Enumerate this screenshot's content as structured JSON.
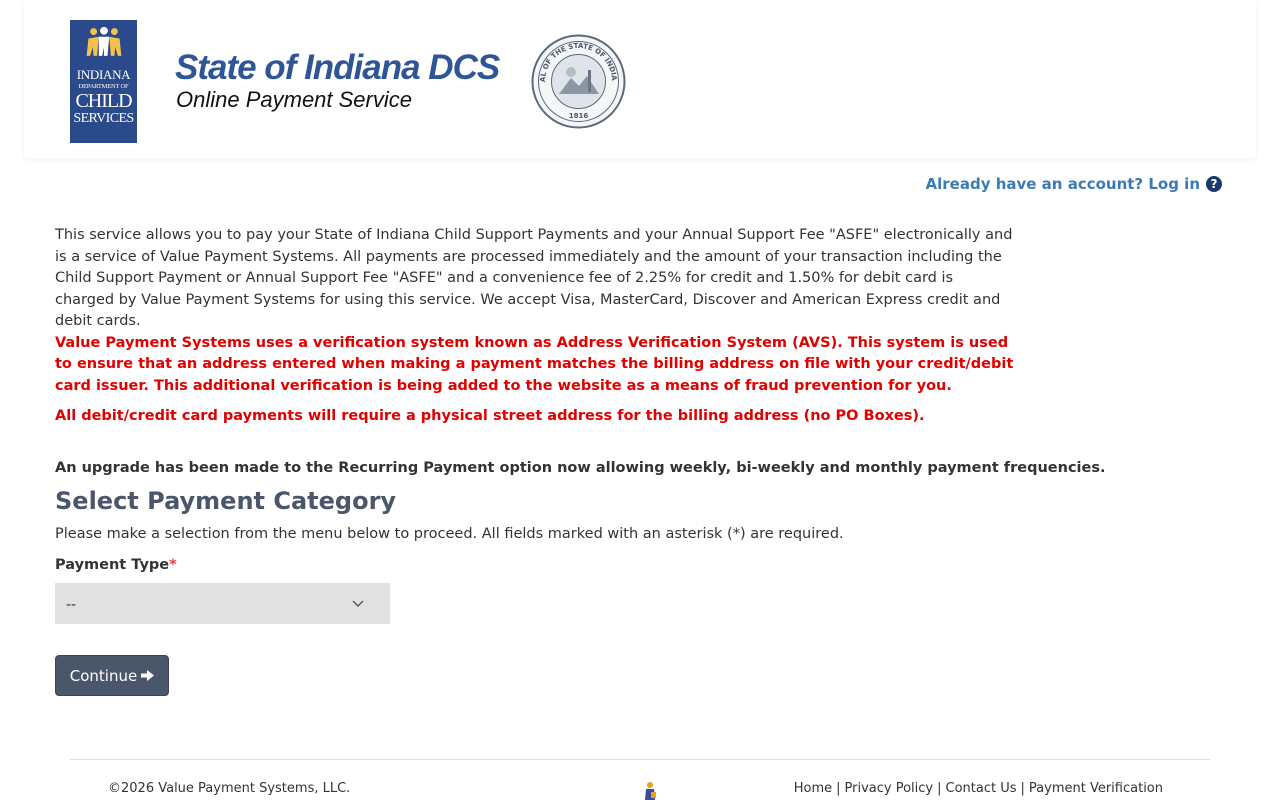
{
  "header": {
    "logo": {
      "line1": "INDIANA",
      "line2": "DEPARTMENT OF",
      "line3": "CHILD",
      "line4": "SERVICES"
    },
    "title": "State of Indiana DCS",
    "subtitle": "Online Payment Service",
    "seal_text": "SEAL OF THE STATE OF INDIANA",
    "seal_year": "1816"
  },
  "login": {
    "label": "Already have an account? Log in",
    "help_icon": "question-circle-icon"
  },
  "intro": {
    "paragraph": "This service allows you to pay your State of Indiana Child Support Payments and your Annual Support Fee \"ASFE\" electronically and is a service of Value Payment Systems. All payments are processed immediately and the amount of your transaction including the Child Support Payment or Annual Support Fee \"ASFE\" and a convenience fee of 2.25% for credit and 1.50% for debit card is charged by Value Payment Systems for using this service. We accept Visa, MasterCard, Discover and American Express credit and debit cards.",
    "avs_warning": "Value Payment Systems uses a verification system known as Address Verification System (AVS). This system is used to ensure that an address entered when making a payment matches the billing address on file with your credit/debit card issuer. This additional verification is being added to the website as a means of fraud prevention for you.",
    "address_warning": "All debit/credit card payments will require a physical street address for the billing address (no PO Boxes).",
    "upgrade_note": "An upgrade has been made to the Recurring Payment option now allowing weekly, bi-weekly and monthly payment frequencies."
  },
  "form": {
    "title": "Select Payment Category",
    "description": "Please make a selection from the menu below to proceed. All fields marked with an asterisk (*) are required.",
    "payment_type_label": "Payment Type",
    "required_marker": "*",
    "payment_type_value": "--",
    "continue_label": "Continue"
  },
  "footer": {
    "copyright": "©2026 Value Payment Systems, LLC.",
    "links": [
      "Home",
      "Privacy Policy",
      "Contact Us",
      "Payment Verification"
    ],
    "separator": "|"
  },
  "colors": {
    "brand_blue": "#2f5597",
    "logo_blue": "#2b4a8b",
    "link_blue": "#3a7ab5",
    "warning_red": "#e00000",
    "button_slate": "#4a5669",
    "select_grey": "#e1e1e1"
  }
}
